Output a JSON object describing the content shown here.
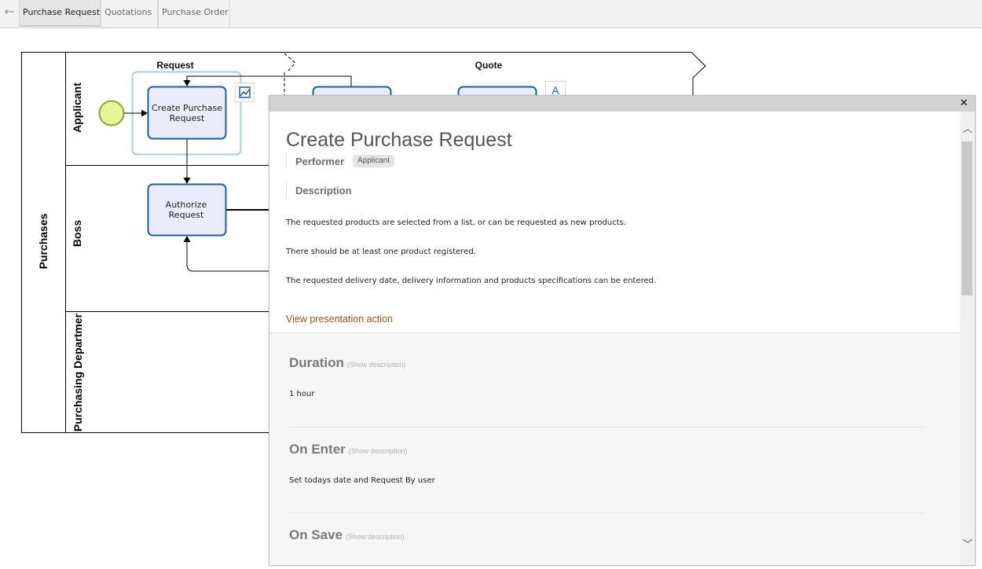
{
  "tabs": [
    "Purchase Request",
    "Quotations",
    "Purchase Order"
  ],
  "diagram": {
    "pool_label": "Purchases",
    "lanes": [
      "Applicant",
      "Boss",
      "Purchasing Departmer"
    ],
    "phases": [
      "Request",
      "Quote"
    ],
    "tasks": {
      "create_purchase_request": [
        "Create Purchase",
        "Request"
      ],
      "authorize_request": [
        "Authorize",
        "Request"
      ]
    }
  },
  "panel": {
    "title": "Create Purchase Request",
    "performer_label": "Performer",
    "performer_value": "Applicant",
    "description_label": "Description",
    "description_lines": [
      "The requested products are selected from a list, or can be requested as new products.",
      "There should be at least one product registered.",
      "The requested delivery date, delivery information and products specifications can be entered."
    ],
    "view_link": "View presentation action",
    "sections": [
      {
        "title": "Duration",
        "hint": "(Show description)",
        "value": "1 hour"
      },
      {
        "title": "On Enter",
        "hint": "(Show description)",
        "value": "Set todays date and Request By user"
      },
      {
        "title": "On Save",
        "hint": "(Show description)",
        "value": ""
      }
    ]
  },
  "colors": {
    "task_fill": "#e8ecfb",
    "task_stroke": "#1f5f9a",
    "start_event_fill": "#e6f598",
    "start_event_stroke": "#8ea52a",
    "link": "#8a5a22"
  },
  "icons": [
    "back-arrow-icon",
    "image-icon",
    "close-icon",
    "chevron-up-icon",
    "chevron-down-icon"
  ]
}
